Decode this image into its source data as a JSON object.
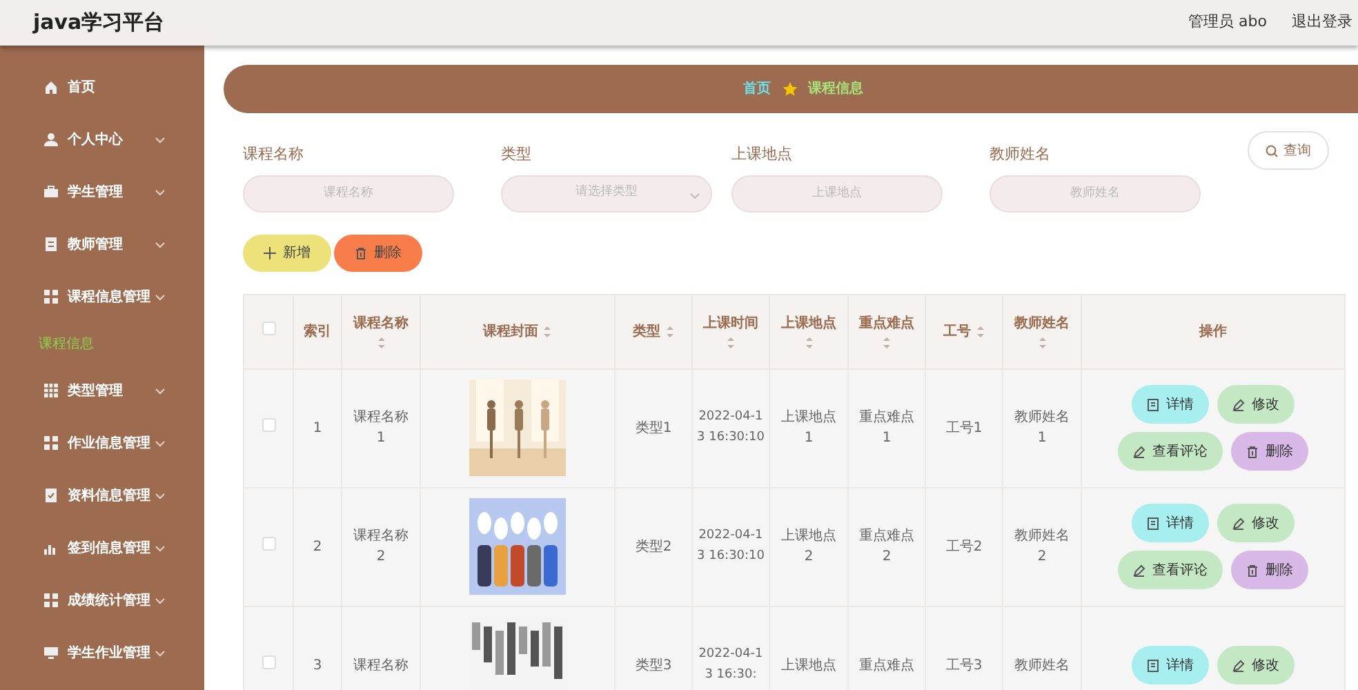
{
  "header": {
    "title": "java学习平台",
    "user": "管理员 abo",
    "logout": "退出登录"
  },
  "sidebar": {
    "items": [
      {
        "label": "首页",
        "kind": "link"
      },
      {
        "label": "个人中心",
        "kind": "menu"
      },
      {
        "label": "学生管理",
        "kind": "menu"
      },
      {
        "label": "教师管理",
        "kind": "menu"
      },
      {
        "label": "课程信息管理",
        "kind": "menu",
        "children": [
          {
            "label": "课程信息",
            "selected": true
          }
        ]
      },
      {
        "label": "类型管理",
        "kind": "menu"
      },
      {
        "label": "作业信息管理",
        "kind": "menu"
      },
      {
        "label": "资料信息管理",
        "kind": "menu"
      },
      {
        "label": "签到信息管理",
        "kind": "menu"
      },
      {
        "label": "成绩统计管理",
        "kind": "menu"
      },
      {
        "label": "学生作业管理",
        "kind": "menu"
      }
    ]
  },
  "breadcrumb": [
    "首页",
    "课程信息"
  ],
  "filters": [
    {
      "label": "课程名称",
      "placeholder": "课程名称",
      "kind": "text"
    },
    {
      "label": "类型",
      "placeholder": "请选择类型",
      "kind": "select"
    },
    {
      "label": "上课地点",
      "placeholder": "上课地点",
      "kind": "text"
    },
    {
      "label": "教师姓名",
      "placeholder": "教师姓名",
      "kind": "text"
    }
  ],
  "search_button": "查询",
  "actions": [
    {
      "label": "新增",
      "kind": "add"
    },
    {
      "label": "删除",
      "kind": "delete"
    }
  ],
  "table": {
    "all_checked": false,
    "columns": [
      {
        "kind": "check"
      },
      {
        "label": "索引",
        "sortable": false
      },
      {
        "label": "课程名称",
        "sortable": true
      },
      {
        "label": "课程封面",
        "sortable": true
      },
      {
        "label": "类型",
        "sortable": true
      },
      {
        "label": "上课时间",
        "sortable": true
      },
      {
        "label": "上课地点",
        "sortable": true
      },
      {
        "label": "重点难点",
        "sortable": true
      },
      {
        "label": "工号",
        "sortable": true
      },
      {
        "label": "教师姓名",
        "sortable": true
      },
      {
        "label": "操作",
        "sortable": false
      }
    ],
    "rows": [
      {
        "checked": false,
        "index": "1",
        "name": "课程名称1",
        "cover": {
          "kind": "picture"
        },
        "type": "类型1",
        "time": "2022-04-13 16:30:10",
        "location": "上课地点1",
        "key_points": "重点难点1",
        "staff_no": "工号1",
        "teacher": "教师姓名1",
        "buttons": [
          {
            "label": "详情",
            "kind": "detail"
          },
          {
            "label": "修改",
            "kind": "edit"
          },
          {
            "label": "查看评论",
            "kind": "comment"
          },
          {
            "label": "删除",
            "kind": "delete"
          }
        ]
      },
      {
        "checked": false,
        "index": "2",
        "name": "课程名称2",
        "cover": {
          "kind": "picture"
        },
        "type": "类型2",
        "time": "2022-04-13 16:30:10",
        "location": "上课地点2",
        "key_points": "重点难点2",
        "staff_no": "工号2",
        "teacher": "教师姓名2",
        "buttons": [
          {
            "label": "详情",
            "kind": "detail"
          },
          {
            "label": "修改",
            "kind": "edit"
          },
          {
            "label": "查看评论",
            "kind": "comment"
          },
          {
            "label": "删除",
            "kind": "delete"
          }
        ]
      },
      {
        "checked": false,
        "index": "3",
        "name": "课程名称",
        "cover": {
          "kind": "picture"
        },
        "type": "类型3",
        "time": "2022-04-13 16:30:",
        "location": "上课地点",
        "key_points": "重点难点",
        "staff_no": "工号3",
        "teacher": "教师姓名",
        "buttons": [
          {
            "label": "详情",
            "kind": "detail"
          },
          {
            "label": "修改",
            "kind": "edit"
          }
        ]
      }
    ]
  }
}
